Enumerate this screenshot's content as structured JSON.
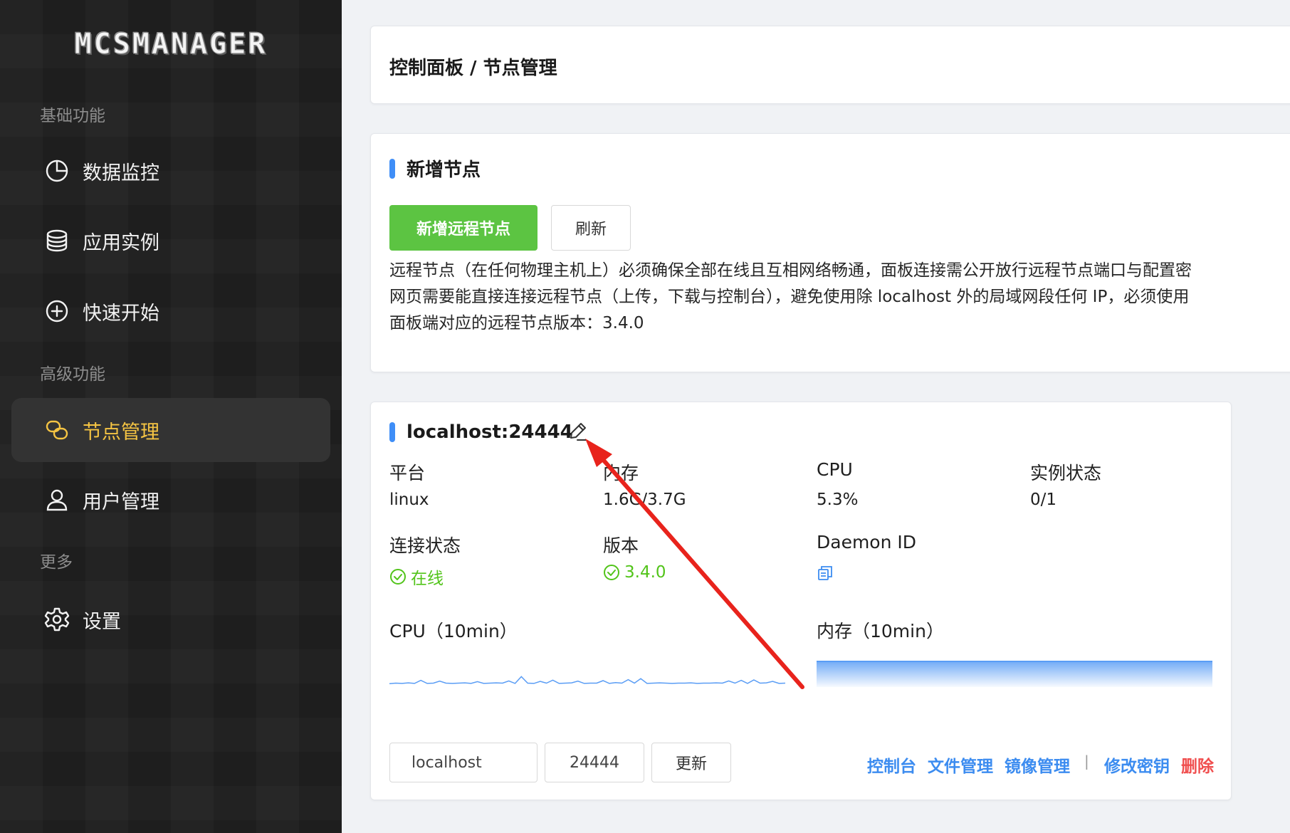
{
  "sidebar": {
    "logo_text": "MCSMANAGER",
    "sections": [
      {
        "label": "基础功能"
      },
      {
        "label": "高级功能"
      },
      {
        "label": "更多"
      }
    ],
    "items": [
      {
        "label": "数据监控",
        "icon": "pie-chart-icon"
      },
      {
        "label": "应用实例",
        "icon": "database-icon"
      },
      {
        "label": "快速开始",
        "icon": "plus-circle-icon"
      },
      {
        "label": "节点管理",
        "icon": "nodes-icon",
        "active": true
      },
      {
        "label": "用户管理",
        "icon": "user-icon"
      },
      {
        "label": "设置",
        "icon": "gear-icon"
      }
    ],
    "active_color": "#f5c443"
  },
  "breadcrumb": "控制面板 / 节点管理",
  "add_node": {
    "title": "新增节点",
    "add_button": "新增远程节点",
    "refresh_button": "刷新",
    "description_lines": [
      "远程节点（在任何物理主机上）必须确保全部在线且互相网络畅通，面板连接需公开放行远程节点端口与配置密",
      "网页需要能直接连接远程节点（上传，下载与控制台），避免使用除 localhost 外的局域网段任何 IP，必须使用",
      "面板端对应的远程节点版本：3.4.0"
    ]
  },
  "node": {
    "title": "localhost:24444",
    "edit_icon": "edit-icon",
    "labels": {
      "platform": "平台",
      "memory": "内存",
      "cpu": "CPU",
      "instances": "实例状态",
      "connection": "连接状态",
      "version": "版本",
      "daemon_id": "Daemon ID"
    },
    "values": {
      "platform": "linux",
      "memory": "1.6G/3.7G",
      "cpu": "5.3%",
      "instances": "0/1",
      "connection": "在线",
      "version": "3.4.0"
    },
    "copy_icon": "copy-icon",
    "cpu_chart_label": "CPU（10min）",
    "mem_chart_label": "内存（10min）",
    "host_input": "localhost",
    "port_input": "24444",
    "update_button": "更新",
    "actions": [
      "控制台",
      "文件管理",
      "镜像管理"
    ],
    "separator": "|",
    "change_key": "修改密钥",
    "delete": "删除",
    "colors": {
      "ok": "#52c41a",
      "link": "#3c8cf0",
      "danger": "#f04e4e",
      "chart": "#5a9df5"
    }
  },
  "chart_data": [
    {
      "type": "line",
      "title": "CPU（10min）",
      "series": [
        {
          "values": [
            0.8,
            1.0,
            0.9,
            1.1,
            0.9,
            2.1,
            0.9,
            1.0,
            1.8,
            1.0,
            0.9,
            1.0,
            1.1,
            0.9,
            1.6,
            0.9,
            1.0,
            1.1,
            1.0,
            1.9,
            0.9,
            3.6,
            1.0,
            0.9,
            1.7,
            1.0,
            2.2,
            0.9,
            1.0,
            1.1,
            1.8,
            0.9,
            1.0,
            1.0,
            2.0,
            0.9,
            1.2,
            1.0,
            2.4,
            1.0,
            2.8,
            0.9,
            1.0,
            1.1,
            1.0,
            0.9,
            1.0,
            1.0,
            1.1,
            0.9,
            1.0,
            1.0,
            1.1,
            1.0,
            1.9,
            1.0,
            2.1,
            0.9,
            2.3,
            1.0,
            1.1,
            1.7,
            0.9,
            1.0
          ]
        }
      ],
      "ylim": [
        0,
        100
      ]
    },
    {
      "type": "area",
      "title": "内存（10min）",
      "series": [
        {
          "values": [
            43,
            43,
            43,
            43,
            43,
            43,
            43,
            43,
            43,
            43,
            43,
            43,
            43,
            43,
            43,
            43,
            43,
            43,
            43,
            43
          ]
        }
      ],
      "ylim": [
        0,
        100
      ]
    }
  ]
}
